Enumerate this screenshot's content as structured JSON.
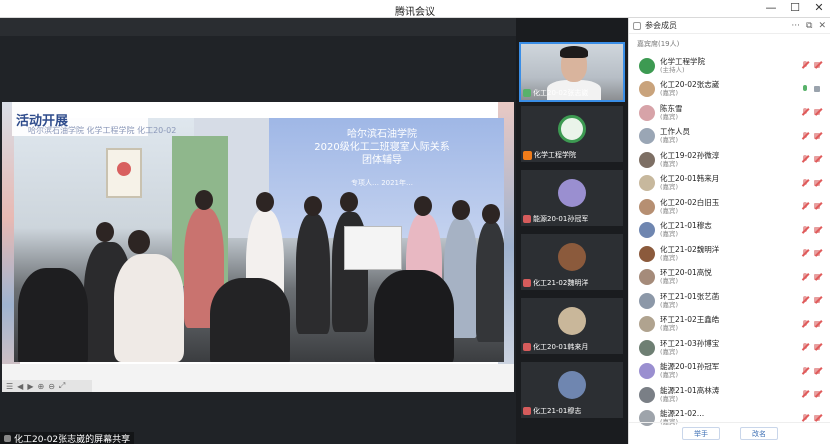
{
  "window": {
    "title": "腾讯会议",
    "min": "—",
    "max": "☐",
    "close": "✕"
  },
  "slide": {
    "title": "活动开展",
    "subtitle": "哈尔滨石油学院 化学工程学院 化工20-02",
    "banner": [
      "哈尔滨石油学院",
      "2020级化工二班寝室人际关系",
      "团体辅导"
    ],
    "banner_sub": "专项人…  2021年…"
  },
  "share_label": "化工20-02张志崴的屏幕共享",
  "share_toolbar": [
    "☰",
    "◀",
    "▶",
    "⊕",
    "⊖",
    "⤢"
  ],
  "tiles": [
    {
      "label": "化工20-02张志崴",
      "type": "video",
      "host": false
    },
    {
      "label": "化学工程学院",
      "type": "logo",
      "host": true
    },
    {
      "label": "能源20-01孙冠军",
      "type": "avatar",
      "host": false
    },
    {
      "label": "化工21-02魏明洋",
      "type": "avatar",
      "host": false
    },
    {
      "label": "化工20-01韩来月",
      "type": "avatar",
      "host": false
    },
    {
      "label": "化工21-01穆志",
      "type": "avatar",
      "host": false
    }
  ],
  "panel": {
    "title": "参会成员",
    "header_buttons": [
      "···",
      "⧉",
      "✕"
    ],
    "group_label": "嘉宾席(19人)",
    "participants": [
      {
        "name": "化学工程学院",
        "role": "(主持人)",
        "me": false
      },
      {
        "name": "化工20-02张志崴",
        "role": "(嘉宾)",
        "me": true
      },
      {
        "name": "陈东雪",
        "role": "(嘉宾)",
        "me": false
      },
      {
        "name": "工作人员",
        "role": "(嘉宾)",
        "me": false
      },
      {
        "name": "化工19-02孙微淳",
        "role": "(嘉宾)",
        "me": false
      },
      {
        "name": "化工20-01韩来月",
        "role": "(嘉宾)",
        "me": false
      },
      {
        "name": "化工20-02白旧玉",
        "role": "(嘉宾)",
        "me": false
      },
      {
        "name": "化工21-01穆志",
        "role": "(嘉宾)",
        "me": false
      },
      {
        "name": "化工21-02魏明洋",
        "role": "(嘉宾)",
        "me": false
      },
      {
        "name": "环工20-01高悦",
        "role": "(嘉宾)",
        "me": false
      },
      {
        "name": "环工21-01张艺菡",
        "role": "(嘉宾)",
        "me": false
      },
      {
        "name": "环工21-02王鑫皓",
        "role": "(嘉宾)",
        "me": false
      },
      {
        "name": "环工21-03孙博宝",
        "role": "(嘉宾)",
        "me": false
      },
      {
        "name": "能源20-01孙冠军",
        "role": "(嘉宾)",
        "me": false
      },
      {
        "name": "能源21-01高林涛",
        "role": "(嘉宾)",
        "me": false
      },
      {
        "name": "能源21-02…",
        "role": "(嘉宾)",
        "me": false
      }
    ],
    "footer": {
      "raise_hand": "举手",
      "rename": "改名"
    }
  }
}
